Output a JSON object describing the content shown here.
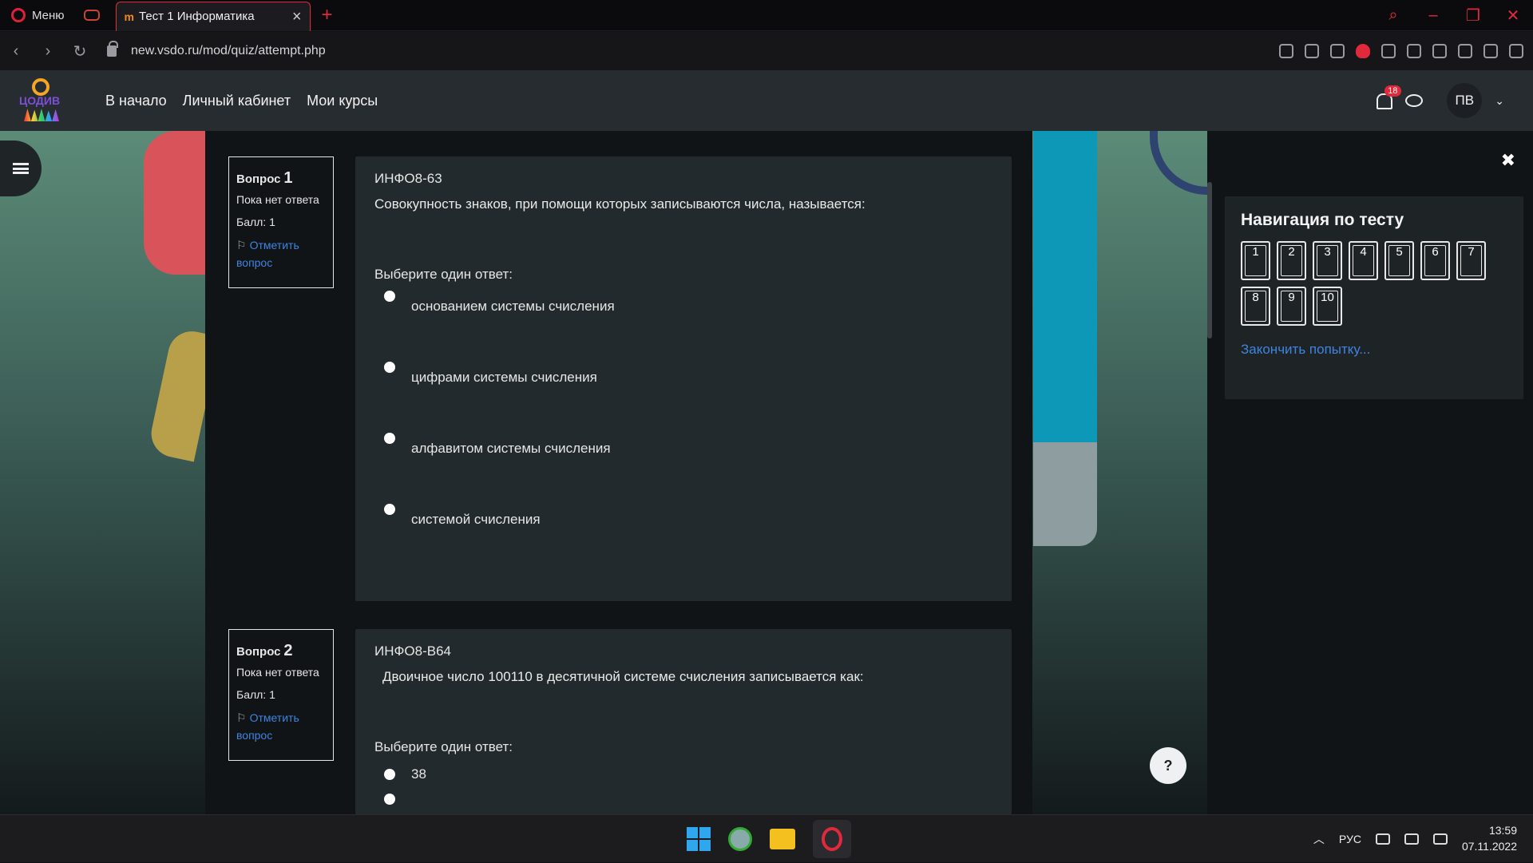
{
  "browser": {
    "menu_label": "Меню",
    "tab_title": "Тест 1 Информатика",
    "url": "new.vsdo.ru/mod/quiz/attempt.php"
  },
  "site": {
    "logo_text": "ЦОДИВ",
    "nav": [
      "В начало",
      "Личный кабинет",
      "Мои курсы"
    ],
    "notification_count": "18",
    "user_initials": "ПВ"
  },
  "questions": [
    {
      "label": "Вопрос",
      "number": "1",
      "status": "Пока нет ответа",
      "score": "Балл: 1",
      "flag_label": "Отметить вопрос",
      "code": "ИНФО8-63",
      "text": "Совокупность знаков, при помощи которых записываются числа, называется:",
      "prompt": "Выберите один ответ:",
      "options": [
        "основанием системы счисления",
        "цифрами системы счисления",
        "алфавитом системы счисления",
        "системой счисления"
      ]
    },
    {
      "label": "Вопрос",
      "number": "2",
      "status": "Пока нет ответа",
      "score": "Балл: 1",
      "flag_label": "Отметить вопрос",
      "code": "ИНФО8-В64",
      "text": "Двоичное число 100110 в десятичной системе счисления записывается как:",
      "prompt": "Выберите один ответ:",
      "options": [
        "38"
      ]
    }
  ],
  "quiz_nav": {
    "title": "Навигация по тесту",
    "buttons": [
      "1",
      "2",
      "3",
      "4",
      "5",
      "6",
      "7",
      "8",
      "9",
      "10"
    ],
    "finish_link": "Закончить попытку..."
  },
  "help_label": "?",
  "taskbar": {
    "language": "РУС",
    "time": "13:59",
    "date": "07.11.2022"
  },
  "colors": {
    "accent_red": "#e02a3c",
    "link_blue": "#3e84e0",
    "header_bg": "#272c31"
  }
}
